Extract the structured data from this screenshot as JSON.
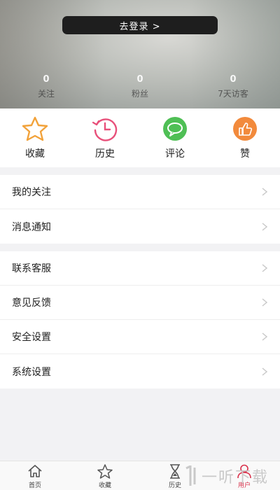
{
  "header": {
    "login_label": "去登录 >",
    "stats": [
      {
        "value": "0",
        "label": "关注"
      },
      {
        "value": "0",
        "label": "粉丝"
      },
      {
        "value": "0",
        "label": "7天访客"
      }
    ]
  },
  "shortcuts": [
    {
      "label": "收藏",
      "icon": "star-icon",
      "color": "#f2a23a"
    },
    {
      "label": "历史",
      "icon": "history-icon",
      "color": "#e8507a"
    },
    {
      "label": "评论",
      "icon": "comment-icon",
      "color": "#4fbf55"
    },
    {
      "label": "赞",
      "icon": "thumbs-up-icon",
      "color": "#f28a3c"
    }
  ],
  "menu_group1": [
    "我的关注",
    "消息通知"
  ],
  "menu_group2": [
    "联系客服",
    "意见反馈",
    "安全设置",
    "系统设置"
  ],
  "tabbar": {
    "tabs": [
      {
        "label": "首页",
        "icon": "home-icon"
      },
      {
        "label": "收藏",
        "icon": "star-icon"
      },
      {
        "label": "历史",
        "icon": "hourglass-icon"
      },
      {
        "label": "用户",
        "icon": "user-icon",
        "active": true
      }
    ],
    "active_color": "#d9304a"
  },
  "watermark": {
    "text": "一听下载"
  }
}
